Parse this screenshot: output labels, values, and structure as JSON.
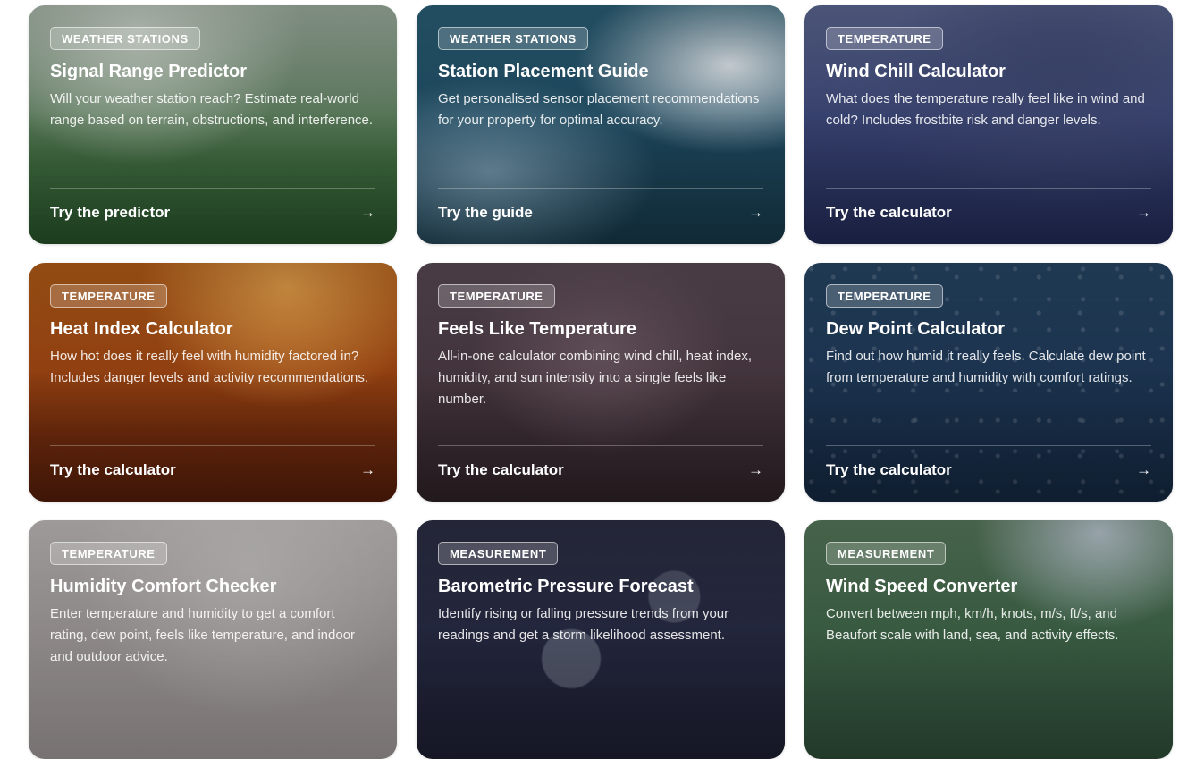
{
  "cards": [
    {
      "badge": "WEATHER STATIONS",
      "title": "Signal Range Predictor",
      "description": "Will your weather station reach? Estimate real-world range based on terrain, obstructions, and interference.",
      "cta": "Try the predictor",
      "arrow": "→"
    },
    {
      "badge": "WEATHER STATIONS",
      "title": "Station Placement Guide",
      "description": "Get personalised sensor placement recommendations for your property for optimal accuracy.",
      "cta": "Try the guide",
      "arrow": "→"
    },
    {
      "badge": "TEMPERATURE",
      "title": "Wind Chill Calculator",
      "description": "What does the temperature really feel like in wind and cold? Includes frostbite risk and danger levels.",
      "cta": "Try the calculator",
      "arrow": "→"
    },
    {
      "badge": "TEMPERATURE",
      "title": "Heat Index Calculator",
      "description": "How hot does it really feel with humidity factored in? Includes danger levels and activity recommendations.",
      "cta": "Try the calculator",
      "arrow": "→"
    },
    {
      "badge": "TEMPERATURE",
      "title": "Feels Like Temperature",
      "description": "All-in-one calculator combining wind chill, heat index, humidity, and sun intensity into a single feels like number.",
      "cta": "Try the calculator",
      "arrow": "→"
    },
    {
      "badge": "TEMPERATURE",
      "title": "Dew Point Calculator",
      "description": "Find out how humid it really feels. Calculate dew point from temperature and humidity with comfort ratings.",
      "cta": "Try the calculator",
      "arrow": "→"
    },
    {
      "badge": "TEMPERATURE",
      "title": "Humidity Comfort Checker",
      "description": "Enter temperature and humidity to get a comfort rating, dew point, feels like temperature, and indoor and outdoor advice.",
      "cta": "",
      "arrow": ""
    },
    {
      "badge": "MEASUREMENT",
      "title": "Barometric Pressure Forecast",
      "description": "Identify rising or falling pressure trends from your readings and get a storm likelihood assessment.",
      "cta": "",
      "arrow": ""
    },
    {
      "badge": "MEASUREMENT",
      "title": "Wind Speed Converter",
      "description": "Convert between mph, km/h, knots, m/s, ft/s, and Beaufort scale with land, sea, and activity effects.",
      "cta": "",
      "arrow": ""
    }
  ]
}
